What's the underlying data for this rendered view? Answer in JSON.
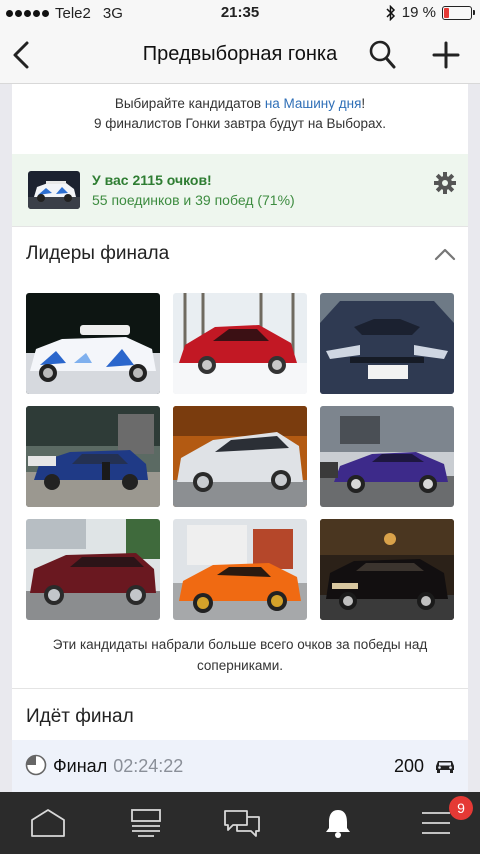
{
  "status_bar": {
    "carrier": "Tele2",
    "network": "3G",
    "time": "21:35",
    "battery": "19 %",
    "battery_level": 0.19
  },
  "nav": {
    "title": "Предвыборная гонка",
    "back_icon": "chevron-left-icon",
    "search_icon": "search-icon",
    "add_icon": "plus-icon"
  },
  "intro": {
    "line1_prefix": "Выбирайте кандидатов",
    "line1_link": "на Машину дня",
    "line1_suffix": "!",
    "line2": "9 финалистов Гонки завтра будут на Выборах."
  },
  "score": {
    "title": "У вас 2115 очков!",
    "subtitle": "55 поединков и 39 побед (71%)"
  },
  "leaders": {
    "title": "Лидеры финала",
    "photos": [
      {
        "name": "photo-white-hatchback-livery"
      },
      {
        "name": "photo-red-alfa-romeo-sedan"
      },
      {
        "name": "photo-dark-subaru-hood"
      },
      {
        "name": "photo-blue-sedan-garage"
      },
      {
        "name": "photo-silver-subaru-wagon"
      },
      {
        "name": "photo-purple-sports-car"
      },
      {
        "name": "photo-maroon-alfa-wagon"
      },
      {
        "name": "photo-orange-toyota-roadster"
      },
      {
        "name": "photo-black-classic-sedan"
      }
    ],
    "note": "Эти кандидаты набрали больше всего очков за победы над соперниками."
  },
  "final": {
    "title": "Идёт финал",
    "label": "Финал",
    "timer": "02:24:22",
    "score": "200"
  },
  "tab_bar": {
    "tabs": [
      "home-icon",
      "feed-icon",
      "messages-icon",
      "notifications-icon",
      "menu-icon"
    ],
    "badge": "9"
  },
  "colors": {
    "accent_link": "#2f6fb7",
    "score_green": "#2e7d32",
    "badge_red": "#e53935",
    "tab_bar_bg": "#2b2b2b"
  }
}
